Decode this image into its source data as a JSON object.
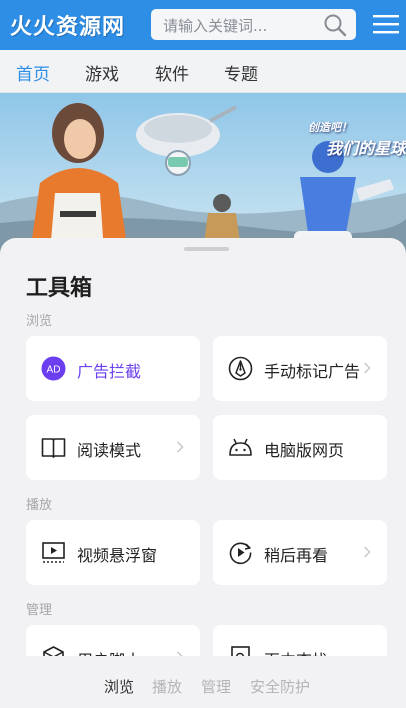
{
  "site": {
    "logo": "火火资源网",
    "search_placeholder": "请输入关键词...",
    "nav": [
      "首页",
      "游戏",
      "软件",
      "专题"
    ],
    "banner_small": "创造吧！",
    "banner_big": "我们的星球"
  },
  "toolbox": {
    "title": "工具箱",
    "sections": {
      "browse": "浏览",
      "play": "播放",
      "manage": "管理"
    },
    "cards": {
      "ad_block": "广告拦截",
      "ad_mark": "手动标记广告",
      "reader_mode": "阅读模式",
      "desktop_page": "电脑版网页",
      "pip": "视频悬浮窗",
      "watch_later": "稍后再看",
      "user_script": "用户脚本",
      "find_in_page": "页内查找"
    },
    "ad_icon_text": "AD",
    "tabs": [
      "浏览",
      "播放",
      "管理",
      "安全防护"
    ],
    "active_tab": "浏览"
  },
  "colors": {
    "accent": "#6b3ff0",
    "header_blue": "#2e8ee6"
  }
}
